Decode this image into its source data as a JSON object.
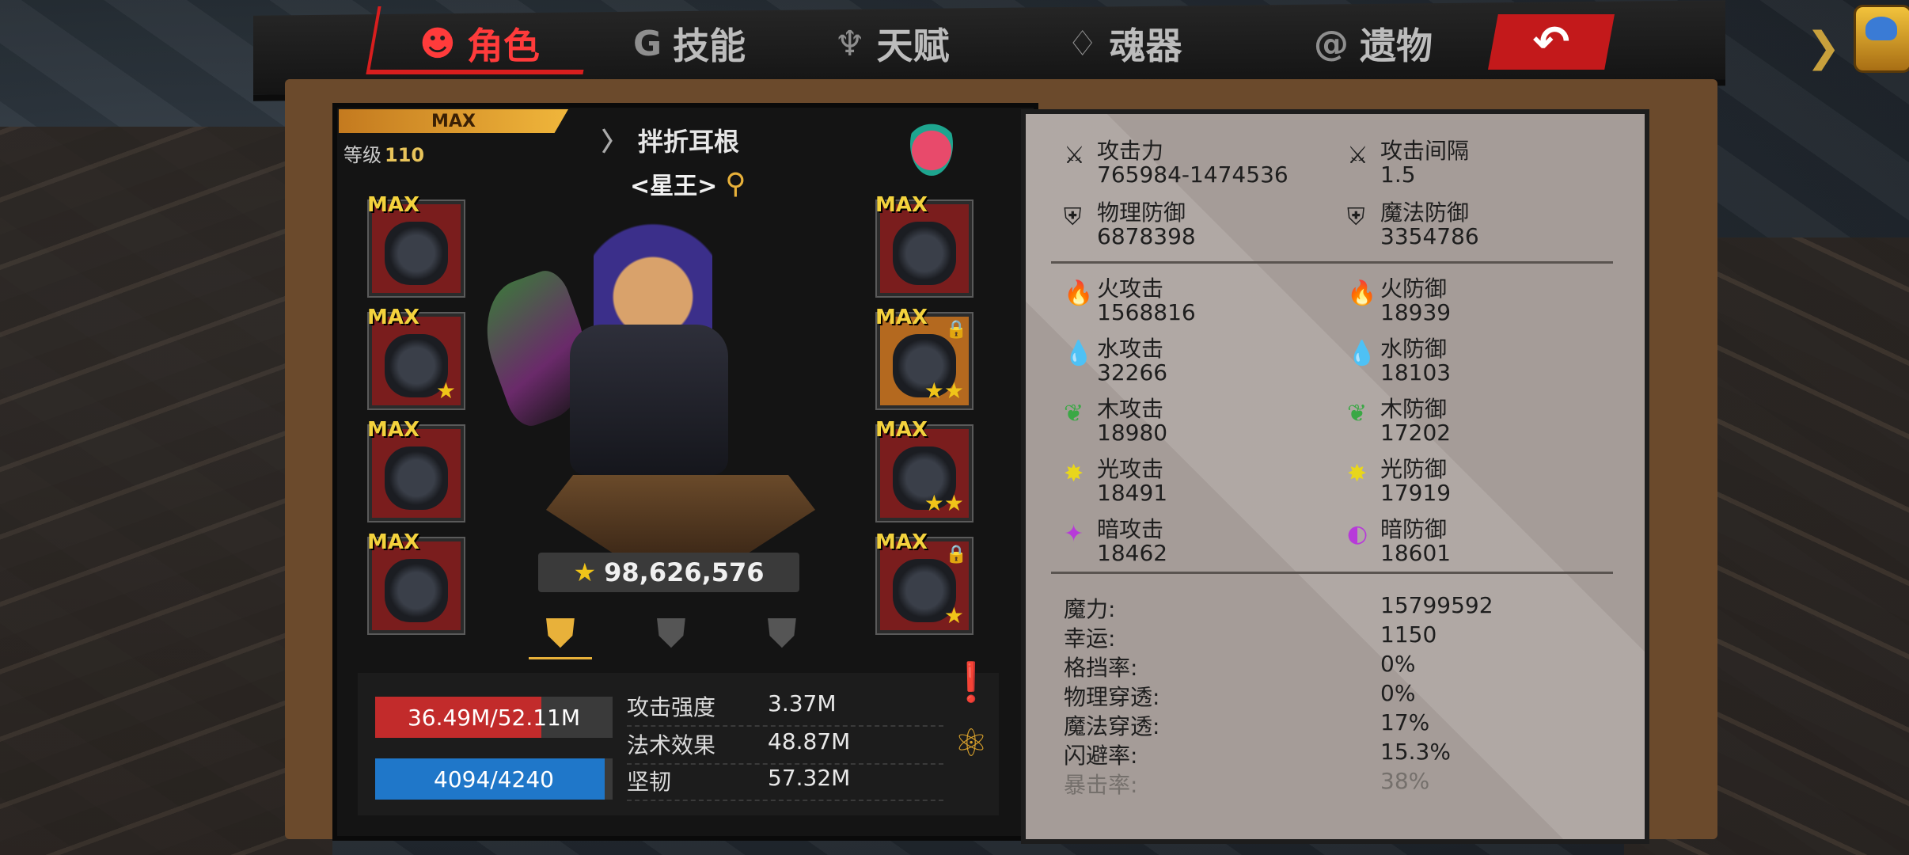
{
  "tabs": [
    {
      "label": "角色",
      "icon": "demon-icon"
    },
    {
      "label": "技能",
      "icon": "g-icon"
    },
    {
      "label": "天赋",
      "icon": "crest-icon"
    },
    {
      "label": "魂器",
      "icon": "flame-icon"
    },
    {
      "label": "遗物",
      "icon": "swirl-icon"
    }
  ],
  "character": {
    "max_badge": "MAX",
    "level_label": "等级",
    "level": "110",
    "name": "拌折耳根",
    "title": "<星王>",
    "power": "98,626,576",
    "hp_text": "36.49M/52.11M",
    "hp_fraction": 0.7,
    "mp_text": "4094/4240",
    "mp_fraction": 0.965
  },
  "slots": {
    "max_label": "MAX",
    "left": [
      {
        "stars": ""
      },
      {
        "stars": "★"
      },
      {
        "stars": ""
      },
      {
        "stars": ""
      }
    ],
    "right": [
      {
        "stars": ""
      },
      {
        "stars": "★★"
      },
      {
        "stars": "★★"
      },
      {
        "stars": "★"
      }
    ]
  },
  "side_stats": [
    {
      "key": "攻击强度",
      "value": "3.37M"
    },
    {
      "key": "法术效果",
      "value": "48.87M"
    },
    {
      "key": "坚韧",
      "value": "57.32M"
    }
  ],
  "stats": {
    "attack_label": "攻击力",
    "attack": "765984-1474536",
    "interval_label": "攻击间隔",
    "interval": "1.5",
    "pdef_label": "物理防御",
    "pdef": "6878398",
    "mdef_label": "魔法防御",
    "mdef": "3354786",
    "fire_atk_label": "火攻击",
    "fire_atk": "1568816",
    "fire_def_label": "火防御",
    "fire_def": "18939",
    "water_atk_label": "水攻击",
    "water_atk": "32266",
    "water_def_label": "水防御",
    "water_def": "18103",
    "wood_atk_label": "木攻击",
    "wood_atk": "18980",
    "wood_def_label": "木防御",
    "wood_def": "17202",
    "light_atk_label": "光攻击",
    "light_atk": "18491",
    "light_def_label": "光防御",
    "light_def": "17919",
    "dark_atk_label": "暗攻击",
    "dark_atk": "18462",
    "dark_def_label": "暗防御",
    "dark_def": "18601"
  },
  "misc": [
    {
      "key": "魔力:",
      "value": "15799592"
    },
    {
      "key": "幸运:",
      "value": "1150"
    },
    {
      "key": "格挡率:",
      "value": "0%"
    },
    {
      "key": "物理穿透:",
      "value": "0%"
    },
    {
      "key": "魔法穿透:",
      "value": "17%"
    },
    {
      "key": "闪避率:",
      "value": "15.3%"
    },
    {
      "key": "暴击率:",
      "value": "38%"
    }
  ],
  "colors": {
    "accent_red": "#d81e1e",
    "gold": "#e8b13a",
    "hp": "#c22b2b",
    "mp": "#1f77c9"
  }
}
